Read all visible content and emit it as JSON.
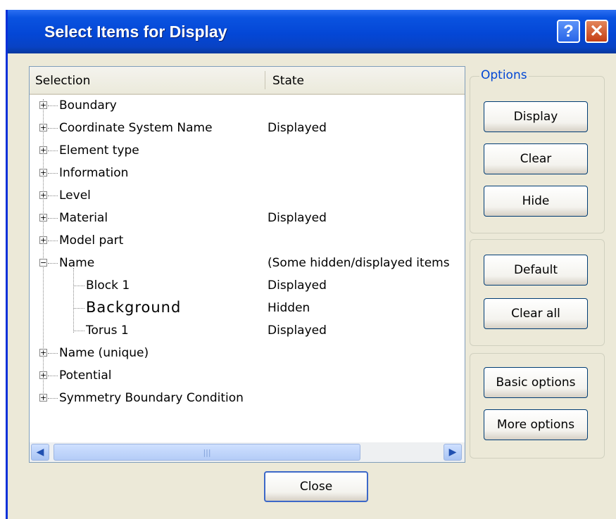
{
  "window": {
    "title": "Select Items for Display",
    "help_glyph": "?",
    "close_glyph": "✕"
  },
  "list": {
    "columns": [
      "Selection",
      "State"
    ],
    "rows": [
      {
        "expander": "+",
        "label": "Boundary",
        "state": ""
      },
      {
        "expander": "+",
        "label": "Coordinate System Name",
        "state": "Displayed"
      },
      {
        "expander": "+",
        "label": "Element type",
        "state": ""
      },
      {
        "expander": "+",
        "label": "Information",
        "state": ""
      },
      {
        "expander": "+",
        "label": "Level",
        "state": ""
      },
      {
        "expander": "+",
        "label": "Material",
        "state": "Displayed"
      },
      {
        "expander": "+",
        "label": "Model part",
        "state": ""
      },
      {
        "expander": "−",
        "label": "Name",
        "state": "(Some hidden/displayed items"
      },
      {
        "expander": "",
        "label": "Block 1",
        "state": "Displayed"
      },
      {
        "expander": "",
        "label": "Background",
        "state": "Hidden"
      },
      {
        "expander": "",
        "label": "Torus 1",
        "state": "Displayed"
      },
      {
        "expander": "+",
        "label": "Name (unique)",
        "state": ""
      },
      {
        "expander": "+",
        "label": "Potential",
        "state": ""
      },
      {
        "expander": "+",
        "label": "Symmetry Boundary Condition",
        "state": ""
      }
    ],
    "scroll_left_glyph": "◀",
    "scroll_right_glyph": "▶",
    "scroll_grip": "|||"
  },
  "options": {
    "group_label": "Options",
    "display_label": "Display",
    "clear_label": "Clear",
    "hide_label": "Hide",
    "default_label": "Default",
    "clear_all_label": "Clear all",
    "basic_options_label": "Basic options",
    "more_options_label": "More options"
  },
  "footer": {
    "close_label": "Close"
  }
}
